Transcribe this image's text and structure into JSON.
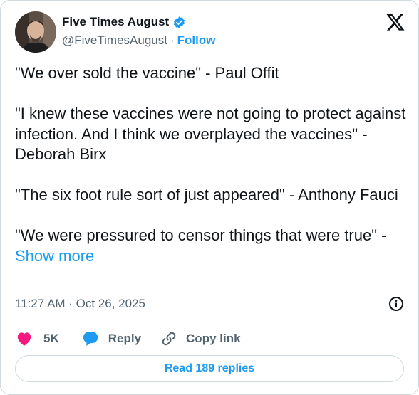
{
  "author": {
    "name": "Five Times August",
    "handle": "@FiveTimesAugust",
    "separator": "·",
    "follow_label": "Follow"
  },
  "tweet": {
    "paragraphs": [
      "\"We over sold the vaccine\" - Paul Offit",
      "\"I knew these vaccines were not going to protect against infection. And I think we overplayed the vaccines\" - Deborah Birx",
      "\"The six foot rule sort of just appeared\" - Anthony Fauci"
    ],
    "last_paragraph": "\"We were pressured to censor things that were true\" - ",
    "show_more_label": "Show more",
    "timestamp": "11:27 AM · Oct 26, 2025"
  },
  "actions": {
    "likes": "5K",
    "reply_label": "Reply",
    "copy_link_label": "Copy link"
  },
  "read_replies_label": "Read 189 replies",
  "colors": {
    "accent": "#1d9bf0",
    "like": "#f91880",
    "text": "#0f1419",
    "secondary_text": "#536471",
    "border": "#cfd9de"
  },
  "icons": [
    "verified-badge-icon",
    "x-logo-icon",
    "info-icon",
    "heart-icon",
    "reply-bubble-icon",
    "link-icon"
  ]
}
